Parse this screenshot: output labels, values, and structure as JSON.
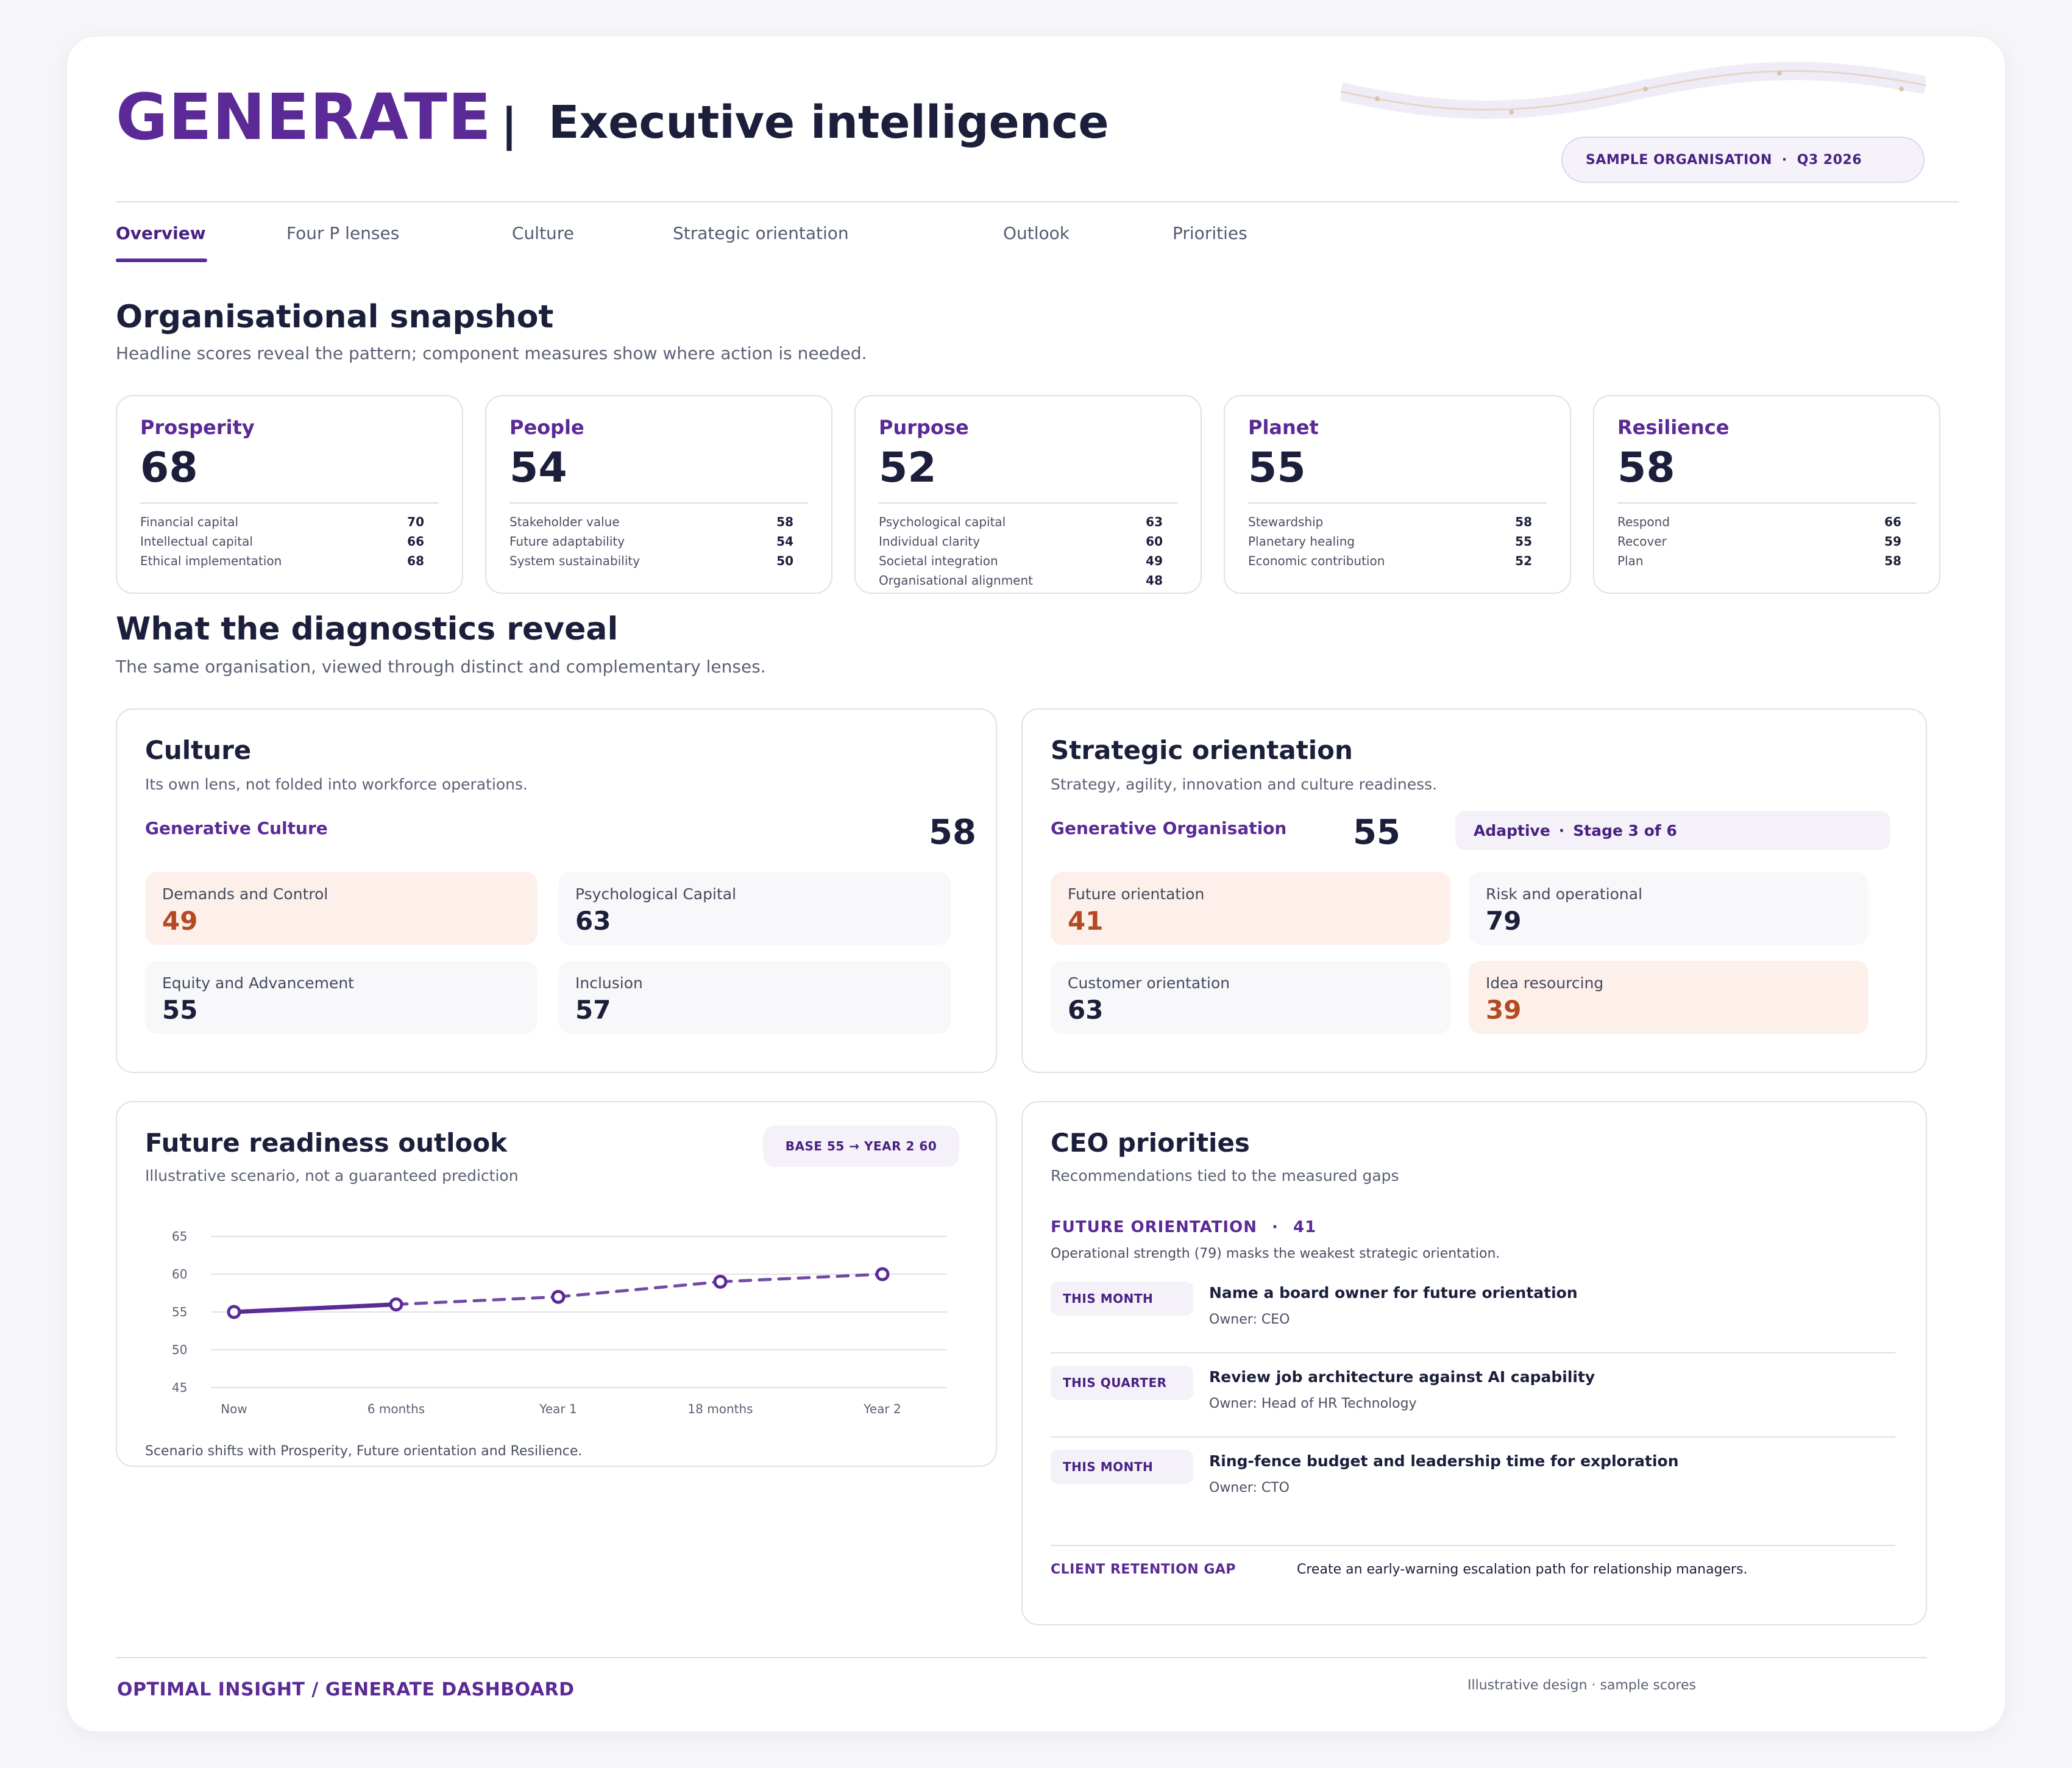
{
  "header": {
    "brand": "GENERATE",
    "separator": "|",
    "subtitle": "Executive intelligence",
    "org_name": "SAMPLE ORGANISATION",
    "dot": "·",
    "period": "Q3 2026"
  },
  "tabs": [
    {
      "label": "Overview",
      "active": true
    },
    {
      "label": "Four P lenses",
      "active": false
    },
    {
      "label": "Culture",
      "active": false
    },
    {
      "label": "Strategic orientation",
      "active": false
    },
    {
      "label": "Outlook",
      "active": false
    },
    {
      "label": "Priorities",
      "active": false
    }
  ],
  "snapshot": {
    "title": "Organisational snapshot",
    "subtitle": "Headline scores reveal the pattern; component measures show where action is needed.",
    "lenses": [
      {
        "name": "Prosperity",
        "score": "68",
        "rows": [
          {
            "label": "Financial capital",
            "value": "70"
          },
          {
            "label": "Intellectual capital",
            "value": "66"
          },
          {
            "label": "Ethical implementation",
            "value": "68"
          }
        ]
      },
      {
        "name": "People",
        "score": "54",
        "rows": [
          {
            "label": "Stakeholder value",
            "value": "58"
          },
          {
            "label": "Future adaptability",
            "value": "54"
          },
          {
            "label": "System sustainability",
            "value": "50"
          }
        ]
      },
      {
        "name": "Purpose",
        "score": "52",
        "rows": [
          {
            "label": "Psychological capital",
            "value": "63"
          },
          {
            "label": "Individual clarity",
            "value": "60"
          },
          {
            "label": "Societal integration",
            "value": "49"
          },
          {
            "label": "Organisational alignment",
            "value": "48"
          }
        ]
      },
      {
        "name": "Planet",
        "score": "55",
        "rows": [
          {
            "label": "Stewardship",
            "value": "58"
          },
          {
            "label": "Planetary healing",
            "value": "55"
          },
          {
            "label": "Economic contribution",
            "value": "52"
          }
        ]
      },
      {
        "name": "Resilience",
        "score": "58",
        "rows": [
          {
            "label": "Respond",
            "value": "66"
          },
          {
            "label": "Recover",
            "value": "59"
          },
          {
            "label": "Plan",
            "value": "58"
          }
        ]
      }
    ]
  },
  "diagnostics": {
    "title": "What the diagnostics reveal",
    "subtitle": "The same organisation, viewed through distinct and complementary lenses."
  },
  "culture": {
    "title": "Culture",
    "subtitle": "Its own lens, not folded into workforce operations.",
    "label": "Generative Culture",
    "score": "58",
    "metrics": [
      {
        "label": "Demands and Control",
        "value": "49",
        "warn": true
      },
      {
        "label": "Psychological Capital",
        "value": "63",
        "warn": false
      },
      {
        "label": "Equity and Advancement",
        "value": "55",
        "warn": false
      },
      {
        "label": "Inclusion",
        "value": "57",
        "warn": false
      }
    ]
  },
  "strategy": {
    "title": "Strategic orientation",
    "subtitle": "Strategy, agility, innovation and culture readiness.",
    "label": "Generative Organisation",
    "score": "55",
    "stage_name": "Adaptive",
    "stage_dot": "·",
    "stage_text": "Stage 3 of 6",
    "metrics": [
      {
        "label": "Future orientation",
        "value": "41",
        "warn": true
      },
      {
        "label": "Risk and operational",
        "value": "79",
        "warn": false
      },
      {
        "label": "Customer orientation",
        "value": "63",
        "warn": false
      },
      {
        "label": "Idea resourcing",
        "value": "39",
        "warn": true
      }
    ]
  },
  "outlook": {
    "title": "Future readiness outlook",
    "subtitle": "Illustrative scenario, not a guaranteed prediction",
    "badge": "BASE 55  →  YEAR 2 60",
    "note": "Scenario shifts with Prosperity, Future orientation and Resilience."
  },
  "chart_data": {
    "type": "line",
    "categories": [
      "Now",
      "6 months",
      "Year 1",
      "18 months",
      "Year 2"
    ],
    "values": [
      55,
      56,
      57,
      59,
      60
    ],
    "solid_until_index": 1,
    "ylim": [
      45,
      65
    ],
    "yticks": [
      "65",
      "60",
      "55",
      "50",
      "45"
    ],
    "grid": true,
    "color": "#5b2a96"
  },
  "priorities": {
    "title": "CEO priorities",
    "subtitle": "Recommendations tied to the measured gaps",
    "focus_label": "FUTURE ORIENTATION",
    "focus_dot": "·",
    "focus_score": "41",
    "focus_desc": "Operational strength (79) masks the weakest strategic orientation.",
    "items": [
      {
        "tag": "THIS MONTH",
        "title": "Name a board owner for future orientation",
        "owner": "Owner: CEO"
      },
      {
        "tag": "THIS QUARTER",
        "title": "Review job architecture against AI capability",
        "owner": "Owner: Head of HR Technology"
      },
      {
        "tag": "THIS MONTH",
        "title": "Ring-fence budget and leadership time for exploration",
        "owner": "Owner: CTO"
      }
    ],
    "gap_label": "CLIENT RETENTION GAP",
    "gap_text": "Create an early-warning escalation path for relationship managers."
  },
  "footer": {
    "left": "OPTIMAL INSIGHT / GENERATE DASHBOARD",
    "right": "Illustrative design · sample scores"
  },
  "colors": {
    "accent": "#5b2a96",
    "text": "#1b1f3b",
    "warn_bg": "#fdf0ea",
    "warn_text": "#b44a24"
  }
}
